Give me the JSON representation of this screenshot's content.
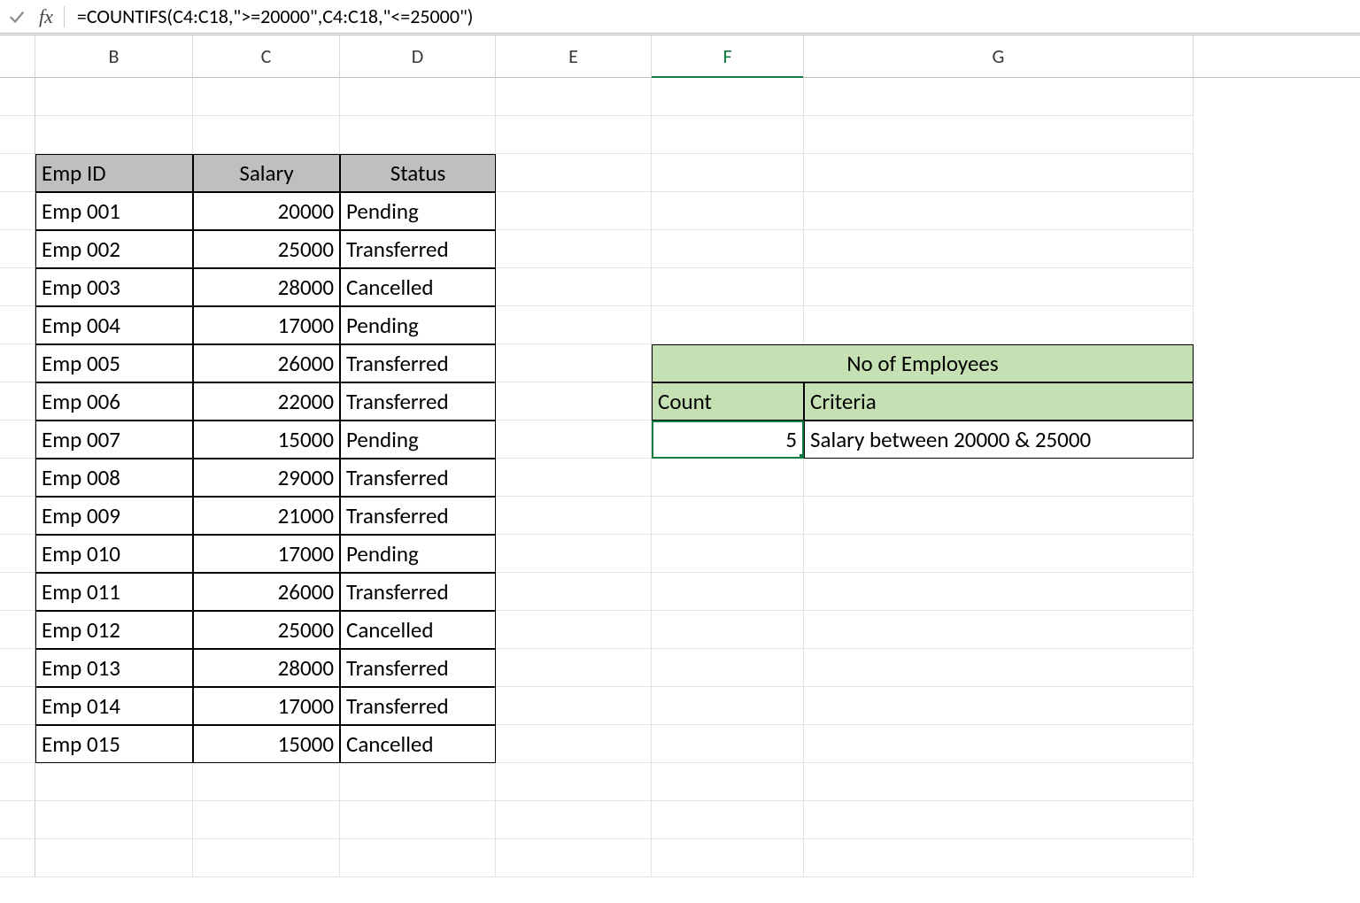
{
  "formula_bar": {
    "fx_label": "fx",
    "formula": "=COUNTIFS(C4:C18,\">=20000\",C4:C18,\"<=25000\")"
  },
  "columns": [
    "B",
    "C",
    "D",
    "E",
    "F",
    "G"
  ],
  "selected_column": "F",
  "data_table": {
    "headers": {
      "emp_id": "Emp ID",
      "salary": "Salary",
      "status": "Status"
    },
    "rows": [
      {
        "emp_id": "Emp 001",
        "salary": "20000",
        "status": "Pending"
      },
      {
        "emp_id": "Emp 002",
        "salary": "25000",
        "status": "Transferred"
      },
      {
        "emp_id": "Emp 003",
        "salary": "28000",
        "status": "Cancelled"
      },
      {
        "emp_id": "Emp 004",
        "salary": "17000",
        "status": "Pending"
      },
      {
        "emp_id": "Emp 005",
        "salary": "26000",
        "status": "Transferred"
      },
      {
        "emp_id": "Emp 006",
        "salary": "22000",
        "status": "Transferred"
      },
      {
        "emp_id": "Emp 007",
        "salary": "15000",
        "status": "Pending"
      },
      {
        "emp_id": "Emp 008",
        "salary": "29000",
        "status": "Transferred"
      },
      {
        "emp_id": "Emp 009",
        "salary": "21000",
        "status": "Transferred"
      },
      {
        "emp_id": "Emp 010",
        "salary": "17000",
        "status": "Pending"
      },
      {
        "emp_id": "Emp 011",
        "salary": "26000",
        "status": "Transferred"
      },
      {
        "emp_id": "Emp 012",
        "salary": "25000",
        "status": "Cancelled"
      },
      {
        "emp_id": "Emp 013",
        "salary": "28000",
        "status": "Transferred"
      },
      {
        "emp_id": "Emp 014",
        "salary": "17000",
        "status": "Transferred"
      },
      {
        "emp_id": "Emp 015",
        "salary": "15000",
        "status": "Cancelled"
      }
    ]
  },
  "summary": {
    "title": "No of Employees",
    "count_label": "Count",
    "criteria_label": "Criteria",
    "count_value": "5",
    "criteria_value": "Salary between 20000 & 25000"
  }
}
